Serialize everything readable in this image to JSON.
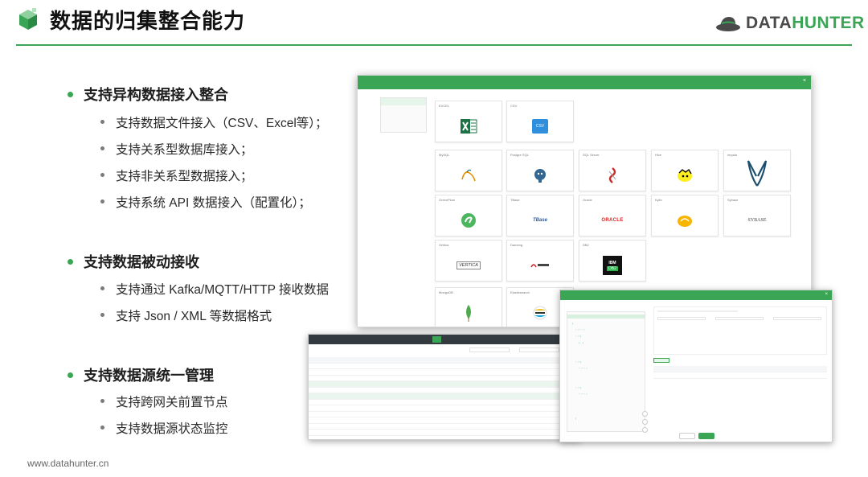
{
  "header": {
    "title": "数据的归集整合能力",
    "logo_prefix": "DATA",
    "logo_suffix": "HUNTER"
  },
  "sections": [
    {
      "heading": "支持异构数据接入整合",
      "items": [
        "支持数据文件接入（CSV、Excel等）；",
        "支持关系型数据库接入；",
        "支持非关系型数据接入；",
        "支持系统 API 数据接入（配置化）；"
      ]
    },
    {
      "heading": "支持数据被动接收",
      "items": [
        "支持通过 Kafka/MQTT/HTTP 接收数据",
        "支持 Json / XML 等数据格式"
      ]
    },
    {
      "heading": "支持数据源统一管理",
      "items": [
        "支持跨网关前置节点",
        "支持数据源状态监控"
      ]
    }
  ],
  "footer": {
    "url": "www.datahunter.cn"
  },
  "colors": {
    "accent": "#3aa655",
    "title": "#111111",
    "text": "#2a2a2a"
  },
  "screenshots": {
    "selection": {
      "tiles": [
        {
          "name": "EXCEL",
          "icon": "excel-icon"
        },
        {
          "name": "CSV",
          "icon": "csv-icon"
        },
        {
          "name": "MySQL",
          "icon": "mysql-icon"
        },
        {
          "name": "Postgre SQL",
          "icon": "postgresql-icon"
        },
        {
          "name": "SQL Server",
          "icon": "sqlserver-icon"
        },
        {
          "name": "Hive",
          "icon": "hive-icon"
        },
        {
          "name": "Impala",
          "icon": "impala-icon"
        },
        {
          "name": "GreenPlum",
          "icon": "greenplum-icon"
        },
        {
          "name": "TBase",
          "icon": "tbase-icon"
        },
        {
          "name": "Oracle",
          "icon": "oracle-icon"
        },
        {
          "name": "Kylin",
          "icon": "kylin-icon"
        },
        {
          "name": "Sybase",
          "icon": "sybase-icon"
        },
        {
          "name": "Vertica",
          "icon": "vertica-icon"
        },
        {
          "name": "Dameng",
          "icon": "dameng-icon"
        },
        {
          "name": "DB2",
          "icon": "db2-icon"
        },
        {
          "name": "MongoDB",
          "icon": "mongodb-icon"
        },
        {
          "name": "Elasticsearch",
          "icon": "elasticsearch-icon"
        }
      ],
      "logos": {
        "tbase": "TBase",
        "oracle": "ORACLE",
        "sybase": "SYBASE",
        "vertica": "VERTICA",
        "ibm": "IBM",
        "db2": "DB2",
        "csv": "CSV"
      }
    }
  }
}
